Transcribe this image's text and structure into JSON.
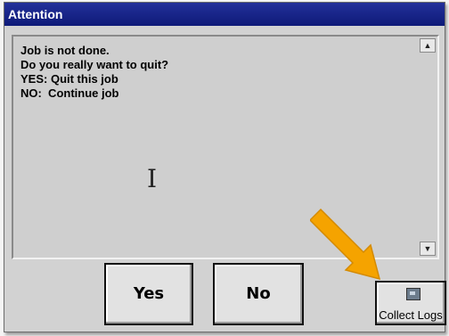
{
  "window": {
    "title": "Attention"
  },
  "message": {
    "lines": [
      "Job is not done.",
      "Do you really want to quit?",
      "YES: Quit this job",
      "NO:  Continue job"
    ]
  },
  "buttons": {
    "yes_label": "Yes",
    "no_label": "No",
    "collect_logs_label": "Collect Logs"
  },
  "icons": {
    "scroll_up": "scroll-up-arrow-icon",
    "scroll_down": "scroll-down-arrow-icon",
    "text_cursor": "text-cursor-icon",
    "collect_logs": "logs-image-icon",
    "annotation_arrow": "orange-arrow-icon"
  },
  "colors": {
    "titlebar": "#0e1a78",
    "annotation_arrow": "#f5a300"
  }
}
